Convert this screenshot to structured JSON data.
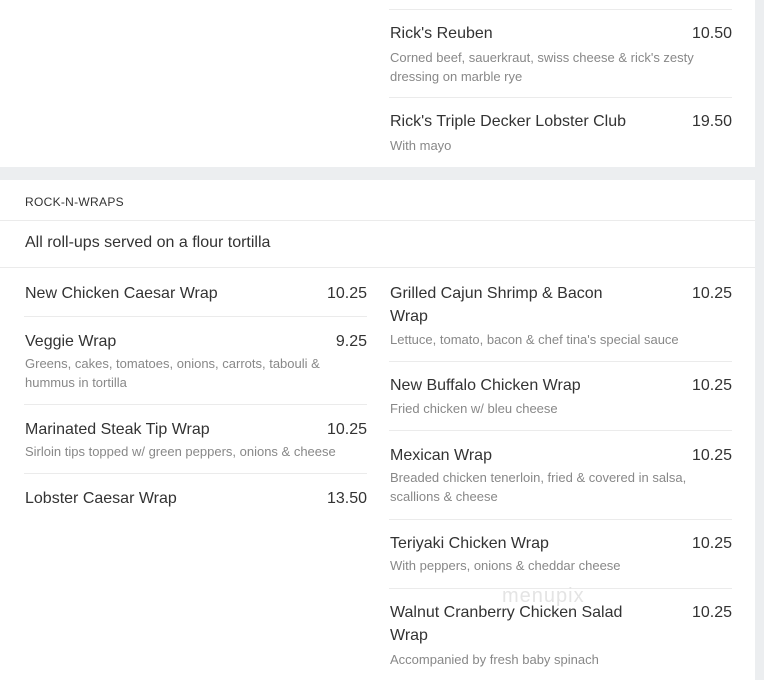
{
  "top_section": {
    "items": [
      {
        "name": "Rick's Reuben",
        "price": "10.50",
        "desc_line1": "Corned beef, sauerkraut, swiss cheese & rick's zesty",
        "desc_line2": "dressing on marble rye"
      },
      {
        "name": "Rick's Triple Decker Lobster Club",
        "price": "19.50",
        "desc_line1": "With mayo"
      }
    ]
  },
  "wraps_section": {
    "title": "ROCK-N-WRAPS",
    "note": "All roll-ups served on a flour tortilla",
    "left_items": [
      {
        "name": "New Chicken Caesar Wrap",
        "price": "10.25"
      },
      {
        "name": "Veggie Wrap",
        "price": "9.25",
        "desc_line1": "Greens, cakes, tomatoes, onions, carrots, tabouli &",
        "desc_line2": "hummus in tortilla"
      },
      {
        "name": "Marinated Steak Tip Wrap",
        "price": "10.25",
        "desc_line1": "Sirloin tips topped w/ green peppers, onions & cheese"
      },
      {
        "name": "Lobster Caesar Wrap",
        "price": "13.50"
      }
    ],
    "right_items": [
      {
        "name_line1": "Grilled Cajun Shrimp & Bacon",
        "name_line2": "Wrap",
        "price": "10.25",
        "desc_line1": "Lettuce, tomato, bacon & chef tina's special sauce"
      },
      {
        "name_line1": "New Buffalo Chicken Wrap",
        "price": "10.25",
        "desc_line1": "Fried chicken w/ bleu cheese"
      },
      {
        "name_line1": "Mexican Wrap",
        "price": "10.25",
        "desc_line1": "Breaded chicken tenerloin, fried & covered in salsa,",
        "desc_line2": "scallions & cheese"
      },
      {
        "name_line1": "Teriyaki Chicken Wrap",
        "price": "10.25",
        "desc_line1": "With peppers, onions & cheddar cheese"
      },
      {
        "name_line1": "Walnut Cranberry Chicken Salad",
        "name_line2": "Wrap",
        "price": "10.25",
        "desc_line1": "Accompanied by fresh baby spinach"
      }
    ]
  },
  "watermark": "menupix"
}
